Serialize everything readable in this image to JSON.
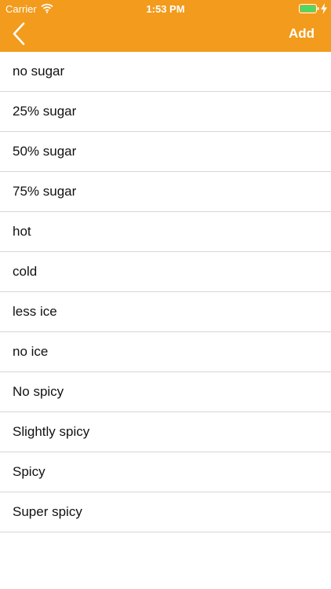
{
  "status_bar": {
    "carrier": "Carrier",
    "time": "1:53 PM",
    "wifi_icon": "wifi-icon",
    "battery_icon": "battery-icon",
    "charging_icon": "bolt-icon",
    "battery_color": "#4cd964"
  },
  "nav": {
    "back_icon": "chevron-left-icon",
    "add_label": "Add",
    "background_color": "#f29b1c"
  },
  "items": [
    {
      "label": "no sugar"
    },
    {
      "label": "25% sugar"
    },
    {
      "label": "50% sugar"
    },
    {
      "label": "75% sugar"
    },
    {
      "label": "hot"
    },
    {
      "label": "cold"
    },
    {
      "label": "less ice"
    },
    {
      "label": "no ice"
    },
    {
      "label": "No spicy"
    },
    {
      "label": "Slightly spicy"
    },
    {
      "label": "Spicy"
    },
    {
      "label": "Super spicy"
    }
  ]
}
